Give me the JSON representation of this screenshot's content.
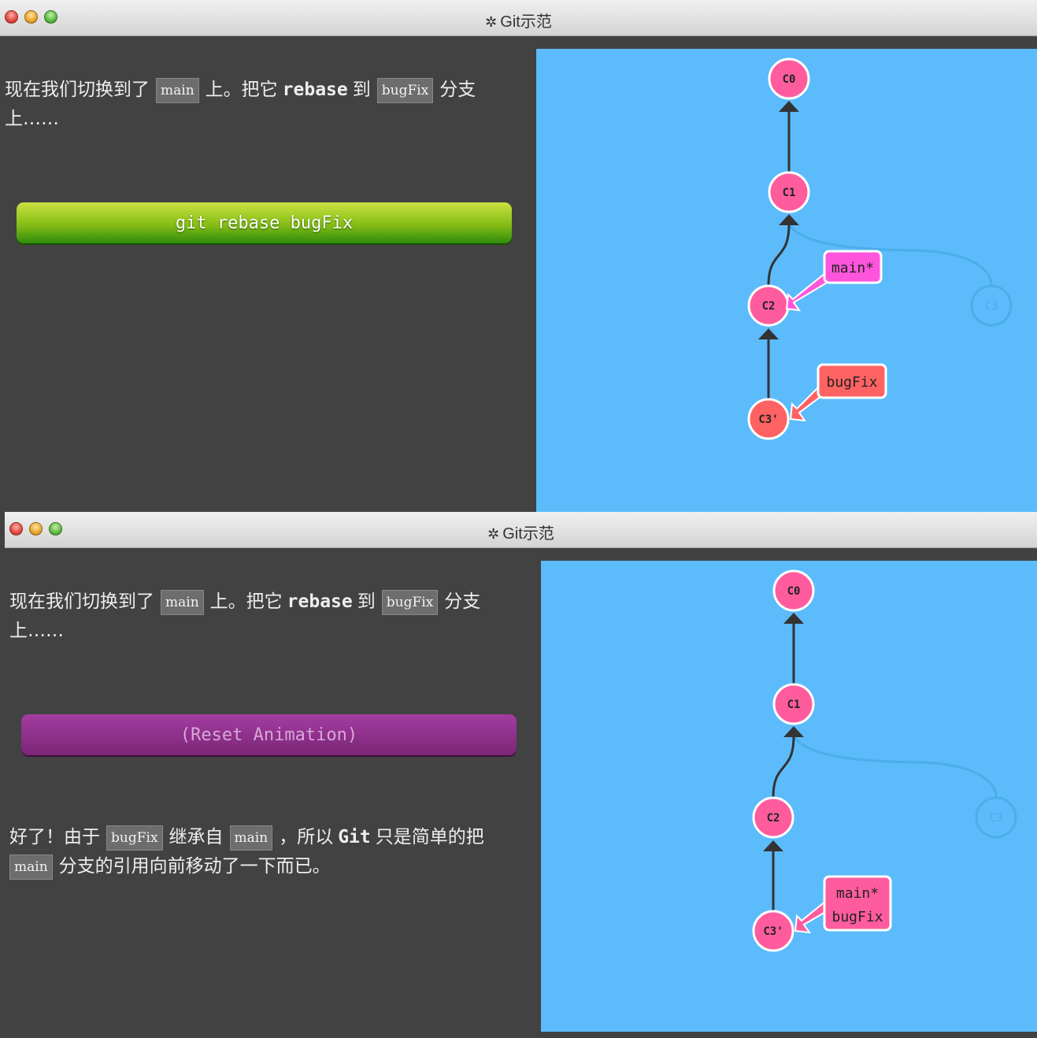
{
  "window_title": "Git示范",
  "panels": [
    {
      "intro": {
        "before": "现在我们切换到了",
        "code1": "main",
        "middle": "上。把它",
        "bold": "rebase",
        "to": "到",
        "code2": "bugFix",
        "after": "分支",
        "line2": "上……"
      },
      "button_label": "git rebase bugFix",
      "commits": {
        "c0": "C0",
        "c1": "C1",
        "c2": "C2",
        "c3": "C3",
        "c3p": "C3'"
      },
      "branches": {
        "main": "main*",
        "bugfix": "bugFix"
      }
    },
    {
      "intro": {
        "before": "现在我们切换到了",
        "code1": "main",
        "middle": "上。把它",
        "bold": "rebase",
        "to": "到",
        "code2": "bugFix",
        "after": "分支",
        "line2": "上……"
      },
      "button_label": "(Reset Animation)",
      "outro": {
        "p1": "好了！由于",
        "code1": "bugFix",
        "p2": "继承自",
        "code2": "main",
        "p3": "，所以",
        "bold": "Git",
        "p4": "只是简单的把",
        "code3": "main",
        "p5": "分支的引用向前移动了一下而已。"
      },
      "commits": {
        "c0": "C0",
        "c1": "C1",
        "c2": "C2",
        "c3": "C3",
        "c3p": "C3'"
      },
      "branches": {
        "main": "main*",
        "bugfix": "bugFix"
      }
    }
  ],
  "colors": {
    "canvas": "#5cbbfb",
    "commit_pink": "#ff5c9e",
    "commit_red": "#ff6262",
    "branch_main": "#ff55dd",
    "branch_bugfix": "#ff6262",
    "ghost_commit": "#4aaee8"
  }
}
